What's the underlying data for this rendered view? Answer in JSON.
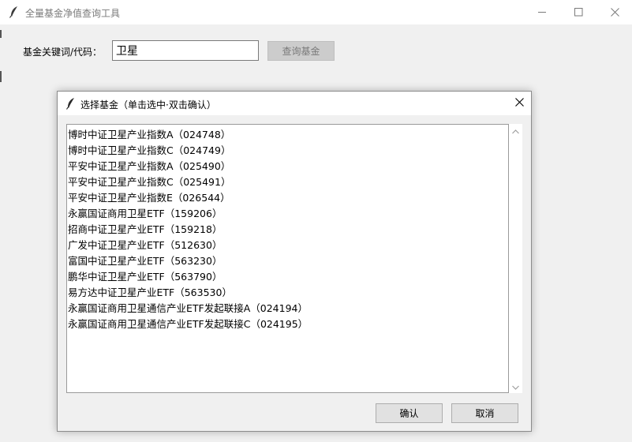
{
  "main_window": {
    "title": "全量基金净值查询工具",
    "search_label": "基金关键词/代码：",
    "search_value": "卫星",
    "query_button": "查询基金"
  },
  "dialog": {
    "title": "选择基金（单击选中·双击确认）",
    "funds": [
      "博时中证卫星产业指数A（024748）",
      "博时中证卫星产业指数C（024749）",
      "平安中证卫星产业指数A（025490）",
      "平安中证卫星产业指数C（025491）",
      "平安中证卫星产业指数E（026544）",
      "永赢国证商用卫星ETF（159206）",
      "招商中证卫星产业ETF（159218）",
      "广发中证卫星产业ETF（512630）",
      "富国中证卫星产业ETF（563230）",
      "鹏华中证卫星产业ETF（563790）",
      "易方达中证卫星产业ETF（563530）",
      "永赢国证商用卫星通信产业ETF发起联接A（024194）",
      "永赢国证商用卫星通信产业ETF发起联接C（024195）"
    ],
    "confirm_button": "确认",
    "cancel_button": "取消"
  },
  "icons": {
    "app": "feather-icon",
    "minimize": "minimize-icon",
    "maximize": "maximize-icon",
    "close": "close-icon",
    "scroll_up": "chevron-up-icon",
    "scroll_down": "chevron-down-icon"
  },
  "colors": {
    "window_bg": "#f0f0f0",
    "titlebar_bg": "#ffffff",
    "disabled_button_bg": "#cccccc",
    "button_bg": "#e1e1e1"
  }
}
